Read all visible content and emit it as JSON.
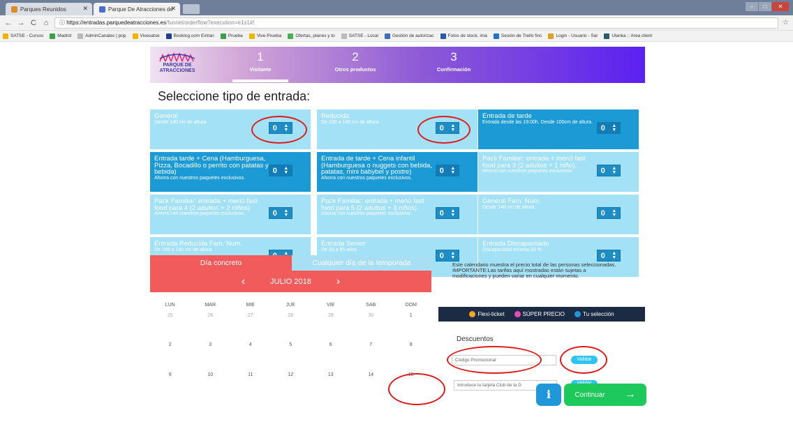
{
  "browser": {
    "tabs": [
      {
        "label": "Parques Reunidos",
        "color": "#e08a2a"
      },
      {
        "label": "Parque De Atracciones de",
        "color": "#4a6fd0"
      }
    ],
    "url_host": "https://entradas.parquedeatracciones.es",
    "url_path": "/funnel/orderflow?execution=e1s1#!",
    "bookmarks": [
      {
        "label": "SATSE - Cursos",
        "color": "#f0b400"
      },
      {
        "label": "Madrid",
        "color": "#3aa04a"
      },
      {
        "label": "AdminCanales | pop",
        "color": "#bbbbbb"
      },
      {
        "label": "Vivesatse",
        "color": "#f0b400"
      },
      {
        "label": "Booking.com Extran",
        "color": "#1f3f8a"
      },
      {
        "label": "Prueba",
        "color": "#3aa04a"
      },
      {
        "label": "Vive-Prueba",
        "color": "#f0b400"
      },
      {
        "label": "Ofertas, planes y to",
        "color": "#4caf50"
      },
      {
        "label": "SATSE - Local",
        "color": "#bbbbbb"
      },
      {
        "label": "Gestión de autorizac",
        "color": "#3a6fc0"
      },
      {
        "label": "Fotos de stock, imá",
        "color": "#2a5ab0"
      },
      {
        "label": "Sesión de Trello finc",
        "color": "#1d77c6"
      },
      {
        "label": "Login - Usuario - Sar",
        "color": "#e0a020"
      },
      {
        "label": "Ulanka :: Area client",
        "color": "#2a5e6a"
      }
    ]
  },
  "header": {
    "logo_line1": "PARQUE DE",
    "logo_line2": "ATRACCIONES",
    "steps": [
      {
        "num": "1",
        "label": "Visitante"
      },
      {
        "num": "2",
        "label": "Otros productos"
      },
      {
        "num": "3",
        "label": "Confirmación"
      }
    ]
  },
  "page_title": "Seleccione tipo de entrada:",
  "tickets": [
    {
      "name": "General",
      "sub": "Desde 140 cm de altura",
      "qty": "0",
      "style": "light"
    },
    {
      "name": "Reducida",
      "sub": "De 100 a 140 cm de altura",
      "qty": "0",
      "style": "light"
    },
    {
      "name": "Entrada de tarde",
      "sub": "Entrada desde las 19:00h. Desde 100cm de altura.",
      "qty": "0",
      "style": "dark"
    },
    {
      "name": "Entrada tarde + Cena (Hamburguesa, Pizza, Bocadillo o perrito con patatas y bebida)",
      "sub": "Ahorra con nuestros paquetes exclusivos.",
      "qty": "0",
      "style": "dark"
    },
    {
      "name": "Entrada de tarde + Cena infantil (Hamburguesa o nuggets con bebida, patatas, mini babybel y postre)",
      "sub": "Ahorra con nuestros paquetes exclusivos.",
      "qty": "0",
      "style": "dark"
    },
    {
      "name": "Pack Familiar: entrada + menú fast food para 3 (2 adultos + 1 niño).",
      "sub": "Ahorra con nuestros paquetes exclusivos.",
      "qty": "0",
      "style": "light"
    },
    {
      "name": "Pack Familiar: entrada + menú fast food para 4 (2 adultos + 2 niños).",
      "sub": "Ahorra con nuestros paquetes exclusivos.",
      "qty": "0",
      "style": "light"
    },
    {
      "name": "Pack Familiar: entrada + menú fast food para 5 (2 adultos + 3 niños).",
      "sub": "Ahorra con nuestros paquetes exclusivos.",
      "qty": "0",
      "style": "light"
    },
    {
      "name": "General Fam. Num.",
      "sub": "Desde 140 cm de altura",
      "qty": "0",
      "style": "light"
    },
    {
      "name": "Entrada Reducida Fam. Num.",
      "sub": "De 100 a 140 cm de altura",
      "qty": "0",
      "style": "light"
    },
    {
      "name": "Entrada Senior",
      "sub": "De 60 a 65 años",
      "qty": "0",
      "style": "light"
    },
    {
      "name": "Entrada Discapacitado",
      "sub": "Discapacidad mínima 33 %",
      "qty": "0",
      "style": "light"
    }
  ],
  "calendar": {
    "tab_active": "Día concreto",
    "tab_inactive": "Cualquier día de la temporada",
    "month": "JULIO 2018",
    "prev": "‹",
    "next": "›",
    "weekdays": [
      "LUN",
      "MAR",
      "MIE",
      "JUE",
      "VIE",
      "SAB",
      "DOM"
    ],
    "weeks": [
      [
        "25",
        "26",
        "27",
        "28",
        "29",
        "30",
        "1"
      ],
      [
        "2",
        "3",
        "4",
        "5",
        "6",
        "7",
        "8"
      ],
      [
        "9",
        "10",
        "11",
        "12",
        "13",
        "14",
        "15"
      ]
    ],
    "note": "Este calendario muestra el precio total de las personas seleccionadas. IMPORTANTE:Las tarifas aquí mostradas están sujetas a modificaciones y pueden variar en cualquier momento."
  },
  "legend": [
    {
      "label": "Flexi-ticket",
      "color": "#f5a623"
    },
    {
      "label": "SÚPER PRECIO",
      "color": "#e84bb2"
    },
    {
      "label": "Tu selección",
      "color": "#1f97d8"
    }
  ],
  "discounts": {
    "title": "Descuentos",
    "promo_placeholder": "Código Promocional",
    "validate_label": "Validar",
    "club_placeholder": "Introduce tu tarjeta Club de la D",
    "validate2_label": "Validar"
  },
  "actions": {
    "info_label": "i",
    "continue_label": "Continuar",
    "continue_arrow": "→"
  }
}
